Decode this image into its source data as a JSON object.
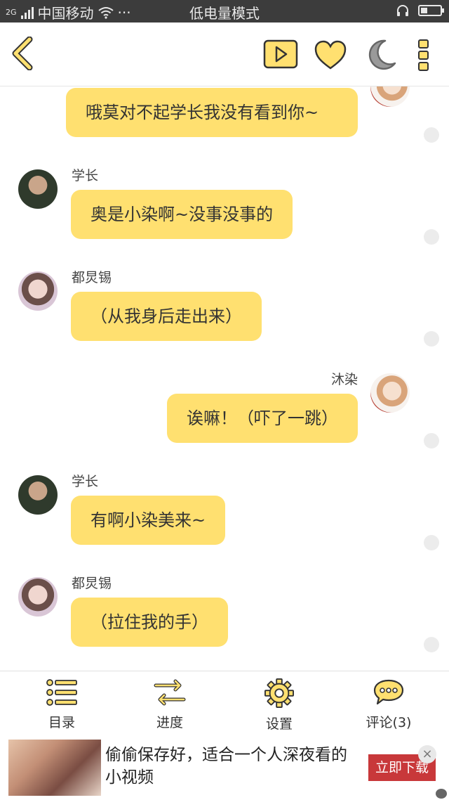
{
  "status_bar": {
    "network": "2G",
    "carrier": "中国移动",
    "more": "···",
    "mode": "低电量模式",
    "battery_level": 0.35
  },
  "header": {
    "back_icon": "back-chevron-icon",
    "play_icon": "play-icon",
    "like_icon": "heart-icon",
    "night_icon": "moon-icon",
    "more_icon": "more-dots-icon",
    "accent": "#ffe070",
    "icon_stroke": "#333333"
  },
  "chat": {
    "messages": [
      {
        "side": "right",
        "speaker": "",
        "text": "哦莫对不起学长我没有看到你~"
      },
      {
        "side": "left",
        "speaker": "学长",
        "text": "奥是小染啊~没事没事的"
      },
      {
        "side": "left",
        "speaker": "都炅锡",
        "text": "（从我身后走出来）"
      },
      {
        "side": "right",
        "speaker": "沐染",
        "text": "诶嘛！（吓了一跳）"
      },
      {
        "side": "left",
        "speaker": "学长",
        "text": "有啊小染美来~"
      },
      {
        "side": "left",
        "speaker": "都炅锡",
        "text": "（拉住我的手）"
      }
    ]
  },
  "bottom_nav": {
    "items": [
      {
        "label": "目录",
        "icon": "list-icon"
      },
      {
        "label": "进度",
        "icon": "swap-arrows-icon"
      },
      {
        "label": "设置",
        "icon": "gear-icon"
      },
      {
        "label": "评论(3)",
        "icon": "comment-icon"
      }
    ]
  },
  "ad": {
    "text": "偷偷保存好，适合一个人深夜看的小视频",
    "button": "立即下载",
    "close": "×"
  }
}
